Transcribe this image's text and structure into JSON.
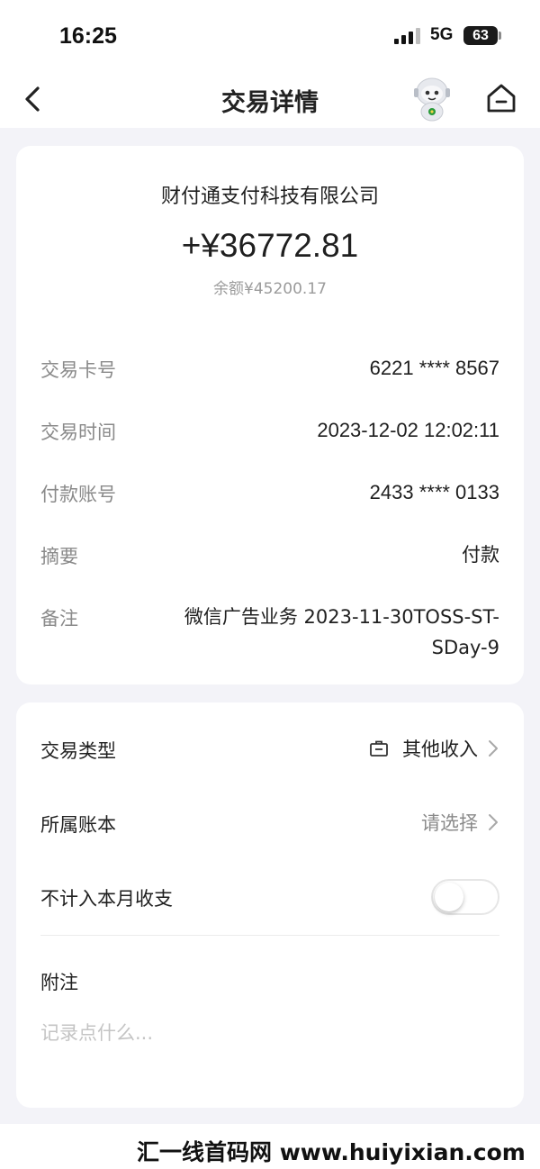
{
  "status_bar": {
    "time": "16:25",
    "network": "5G",
    "battery": "63"
  },
  "nav": {
    "title": "交易详情",
    "back_icon": "chevron-left-icon",
    "home_icon": "home-icon",
    "mascot_icon": "robot-mascot-icon"
  },
  "summary": {
    "merchant": "财付通支付科技有限公司",
    "amount": "+¥36772.81",
    "balance": "余额¥45200.17"
  },
  "details": [
    {
      "label": "交易卡号",
      "value": "6221 **** 8567"
    },
    {
      "label": "交易时间",
      "value": "2023-12-02 12:02:11"
    },
    {
      "label": "付款账号",
      "value": "2433 **** 0133"
    },
    {
      "label": "摘要",
      "value": "付款"
    },
    {
      "label": "备注",
      "value": "微信广告业务 2023-11-30TOSS-ST-SDay-9"
    }
  ],
  "settings": {
    "type_label": "交易类型",
    "type_value": "其他收入",
    "ledger_label": "所属账本",
    "ledger_value": "请选择",
    "exclude_label": "不计入本月收支",
    "exclude_on": false,
    "note_label": "附注",
    "note_placeholder": "记录点什么...",
    "note_value": ""
  },
  "watermark": {
    "text": "汇一线首码网 www.huiyixian.com"
  },
  "colors": {
    "background": "#f3f3f8",
    "card": "#ffffff",
    "secondary_text": "#8a8a8a",
    "placeholder": "#c4c4c4"
  }
}
